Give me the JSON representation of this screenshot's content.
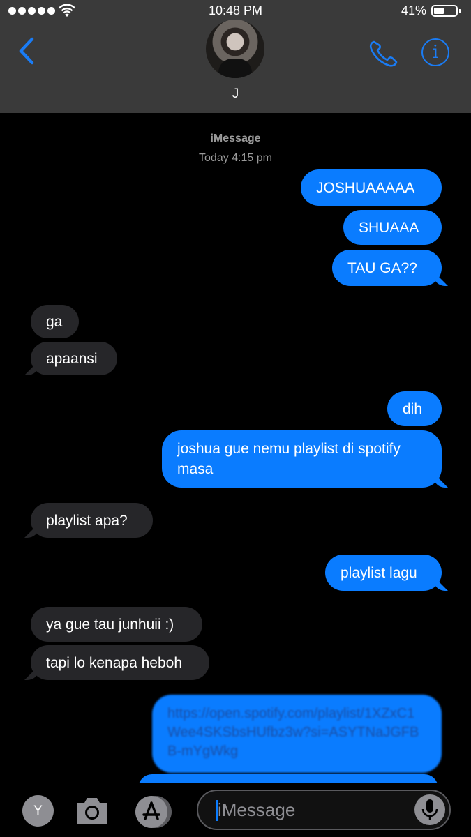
{
  "status_bar": {
    "time": "10:48 PM",
    "battery": "41%"
  },
  "header": {
    "contact_name": "J"
  },
  "conversation": {
    "service": "iMessage",
    "timestamp": "Today 4:15 pm",
    "messages": [
      {
        "side": "sent",
        "text": "JOSHUAAAAA"
      },
      {
        "side": "sent",
        "text": "SHUAAA"
      },
      {
        "side": "sent",
        "text": "TAU GA??"
      },
      {
        "side": "received",
        "text": "ga"
      },
      {
        "side": "received",
        "text": "apaansi"
      },
      {
        "side": "sent",
        "text": "dih"
      },
      {
        "side": "sent",
        "text": "joshua gue nemu playlist di spotify masa"
      },
      {
        "side": "received",
        "text": "playlist apa?"
      },
      {
        "side": "sent",
        "text": "playlist lagu"
      },
      {
        "side": "received",
        "text": "ya gue tau junhuii :)"
      },
      {
        "side": "received",
        "text": "tapi lo kenapa heboh"
      },
      {
        "side": "sent",
        "text": "https://open.spotify.com/playlist/1XZxC1Wee4SKSbsHUfbz3w?si=ASYTNaJGFBB-mYgWkg"
      }
    ]
  },
  "input_bar": {
    "apps_button_label": "Y",
    "placeholder": "iMessage"
  },
  "colors": {
    "accent": "#0a7cff",
    "received_bubble": "#262629",
    "header_bg": "#3a3a3a"
  }
}
